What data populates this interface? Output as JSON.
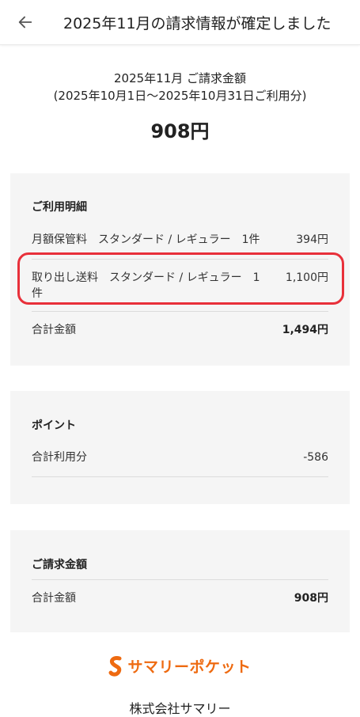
{
  "header": {
    "title": "2025年11月の請求情報が確定しました",
    "back_icon": "arrow-left-icon"
  },
  "summary": {
    "label": "2025年11月 ご請求金額",
    "period": "(2025年10月1日〜2025年10月31日ご利用分)",
    "amount": "908円"
  },
  "usage": {
    "title": "ご利用明細",
    "items": [
      {
        "label": "月額保管料　スタンダード / レギュラー　1件",
        "value": "394円"
      },
      {
        "label_line1": "取り出し送料　スタンダード / レギュラー　1",
        "label_line2": "件",
        "value": "1,100円"
      }
    ],
    "total_label": "合計金額",
    "total_value": "1,494円"
  },
  "points": {
    "title": "ポイント",
    "used_label": "合計利用分",
    "used_value": "-586"
  },
  "billing": {
    "title": "ご請求金額",
    "total_label": "合計金額",
    "total_value": "908円"
  },
  "footer": {
    "logo_text": "サマリーポケット",
    "company": "株式会社サマリー"
  },
  "colors": {
    "highlight": "#e8303a",
    "brand": "#ee6a10",
    "card_bg": "#f5f5f5"
  }
}
